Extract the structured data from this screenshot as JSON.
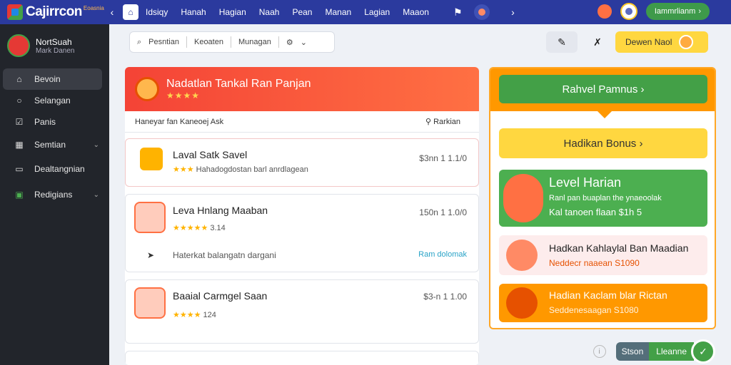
{
  "brand": {
    "logo_text": "Cajirrcon",
    "logo_sub": "Eoasnia"
  },
  "topnav": [
    "Idsiqy",
    "Hanah",
    "Hagian",
    "Naah",
    "Pean",
    "Manan",
    "Lagian",
    "Maaon"
  ],
  "user": {
    "pill_label": "Iammrlianm"
  },
  "sidebar": {
    "profile_name": "NortSuah",
    "profile_sub": "Mark Danen",
    "items": [
      {
        "label": "Bevoin",
        "icon": "home-icon"
      },
      {
        "label": "Selangan",
        "icon": "search-icon"
      },
      {
        "label": "Panis",
        "icon": "check-box-icon"
      },
      {
        "label": "Semtian",
        "icon": "calendar-icon"
      },
      {
        "label": "Dealtangnian",
        "icon": "document-icon"
      },
      {
        "label": "Redigians",
        "icon": "green-square-icon"
      }
    ]
  },
  "filter": {
    "item1": "Pesntian",
    "item2": "Keoaten",
    "item3": "Munagan"
  },
  "actions": {
    "yellow_label": "Dewen Naol"
  },
  "hero": {
    "title": "Nadatlan Tankal Ran Panjan",
    "stars": "★★★★",
    "sub_left": "Haneyar fan Kaneoej Ask",
    "sub_right": "Rarkian"
  },
  "cards": [
    {
      "title": "Laval Satk Savel",
      "sub": "Hahadogdostan barl anrdlagean",
      "stars": "★★★",
      "price": "$3nn 1 1.1/0"
    },
    {
      "title": "Leva Hnlang Maaban",
      "stars": "★★★★★",
      "rating": "3.14",
      "price": "150n 1 1.0/0",
      "note": "Haterkat balangatn dargani",
      "link": "Ram dolomak"
    },
    {
      "title": "Baaial Carmgel Saan",
      "stars": "★★★★",
      "rating": "124",
      "price": "$3-n 1 1.00"
    }
  ],
  "right": {
    "cta": "Rahvel Pamnus",
    "bonus": "Hadikan Bonus",
    "promos": [
      {
        "title": "Level Harian",
        "line1": "Ranl pan buaplan the ynaeoolak",
        "line2": "Kal tanoen flaan $1h 5"
      },
      {
        "title": "Hadkan Kahlaylal Ban Maadian",
        "line1": "Neddecr naaean S1090"
      },
      {
        "title": "Hadian Kaclam blar Rictan",
        "line1": "Seddenesaagan S1080"
      }
    ]
  },
  "bottom": {
    "s_label": "Stson",
    "l_label": "Lleanne"
  }
}
